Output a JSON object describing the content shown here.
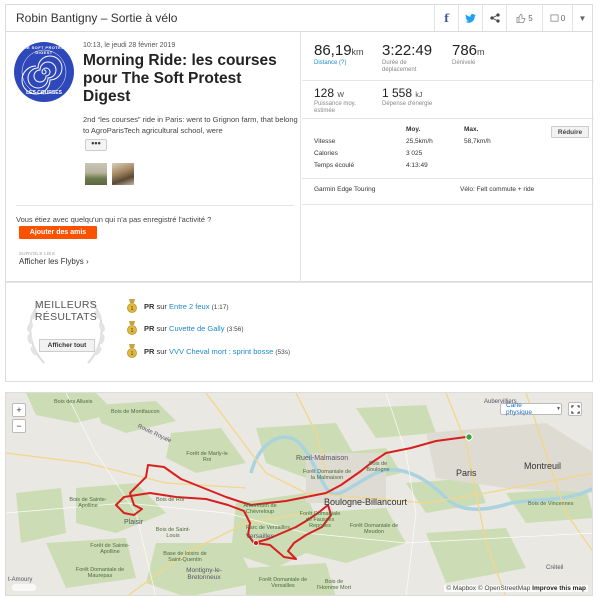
{
  "header": {
    "title": "Robin Bantigny – Sortie à vélo",
    "facebook_icon": "facebook-icon",
    "twitter_icon": "twitter-icon",
    "share_icon": "share-icon",
    "kudos_count": "5",
    "comments_count": "0"
  },
  "activity": {
    "badge_top": "THE SOFT PROTEST DIGEST",
    "badge_bottom": "LES COURSES",
    "date": "10:13, le jeudi 28 février 2019",
    "title": "Morning Ride: les courses pour The Soft Protest Digest",
    "description": "2nd “les courses” ride in Paris: went to Grignon farm, that belong to AgroParisTech agricultural school, were",
    "more_label": "•••",
    "question": "Vous étiez avec quelqu'un qui n'a pas enregistré l'activité ?",
    "add_friends": "Ajouter des amis",
    "flyby_small": "SURVOLS LIES",
    "flyby_link": "Afficher les Flybys ›"
  },
  "stats": {
    "distance": {
      "value": "86,19",
      "unit": "km",
      "label": "Distance (?)"
    },
    "moving_time": {
      "value": "3:22:49",
      "label": "Durée de déplacement"
    },
    "elevation": {
      "value": "786",
      "unit": "m",
      "label": "Dénivelé"
    },
    "power": {
      "value": "128",
      "unit": "W",
      "label": "Puissance moy. estimée"
    },
    "energy": {
      "value": "1 558",
      "unit": "kJ",
      "label": "Dépense d'énergie"
    },
    "table": {
      "col_avg": "Moy.",
      "col_max": "Max.",
      "reduce_label": "Réduire",
      "rows": [
        {
          "label": "Vitesse",
          "avg": "25,5km/h",
          "max": "58,7km/h"
        },
        {
          "label": "Calories",
          "avg": "3 025",
          "max": ""
        },
        {
          "label": "Temps écoulé",
          "avg": "4:13:49",
          "max": ""
        }
      ]
    },
    "device": "Garmin Edge Touring",
    "bike": "Vélo: Felt commute + ride"
  },
  "best": {
    "title_line1": "MEILLEURS",
    "title_line2": "RÉSULTATS",
    "show_all": "Afficher tout",
    "items": [
      {
        "pr": "PR",
        "sur": "sur",
        "segment": "Entre 2 feux",
        "time": "(1:17)"
      },
      {
        "pr": "PR",
        "sur": "sur",
        "segment": "Cuvette de Gally",
        "time": "(3:56)"
      },
      {
        "pr": "PR",
        "sur": "sur",
        "segment": "VVV Cheval mort : sprint bosse",
        "time": "(53s)"
      }
    ]
  },
  "map": {
    "map_type": "Carte physique",
    "attribution_mapbox": "© Mapbox",
    "attribution_osm": "© OpenStreetMap",
    "improve": "Improve this map",
    "labels": {
      "paris": "Paris",
      "boulogne": "Boulogne-Billancourt",
      "montreuil": "Montreuil",
      "rueil": "Rueil-Malmaison",
      "plaisir": "Plaisir",
      "montigny": "Montigny-le-Bretonneux",
      "versailles": "Versailles",
      "bois_allueis": "Bois des Allueis",
      "bois_montfaucon": "Bois de Montfaucon",
      "foret_marly": "Forêt de Marly-le Roi",
      "foret_malmaison": "Forêt Domaniale de la Malmaison",
      "bois_boulogne": "Bois de Boulogne",
      "bois_vincennes": "Bois de Vincennes",
      "foret_meudon": "Forêt Domaniale de Meudon",
      "arboretum": "Arboretum de Chèvreloup",
      "foret_fausses": "Forêt Domaniale de Fausses Reposes",
      "parc_versailles": "Parc de Versailles",
      "bois_roi": "Bois de Roi",
      "bois_st_apolline": "Bois de Sainte-Apolline",
      "bois_st_louis": "Bois de Saint-Louis",
      "foret_st_apolline": "Forêt de Sainte-Apolline",
      "base_loisirs": "Base de loisirs de Saint-Quentin",
      "foret_versailles": "Forêt Domaniale de Versailles",
      "foret_maurepas": "Forêt Domaniale de Maurepas",
      "bois_homme_mort": "Bois de l'Homme Mort",
      "creteil": "Créteil",
      "aubervilliers": "Aubervilliers",
      "route_royale": "Route Royale",
      "st_amoury": "t-Amoury"
    }
  }
}
